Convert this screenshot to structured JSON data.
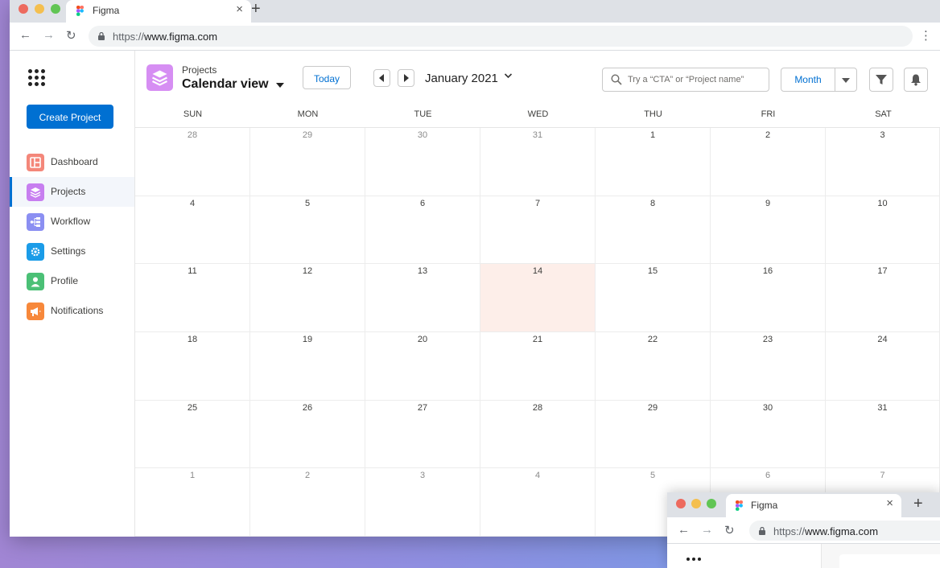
{
  "browser": {
    "tab_title": "Figma",
    "url_scheme": "https://",
    "url_host": "www.figma.com",
    "traffic_lights": [
      "#ed6a5e",
      "#f4bf4f",
      "#61c554"
    ]
  },
  "sidebar": {
    "create_label": "Create Project",
    "items": [
      {
        "label": "Dashboard",
        "icon": "dashboard-icon",
        "color": "#f4877a",
        "active": false
      },
      {
        "label": "Projects",
        "icon": "layers-icon",
        "color": "#c77ef0",
        "active": true
      },
      {
        "label": "Workflow",
        "icon": "workflow-icon",
        "color": "#8b8ff2",
        "active": false
      },
      {
        "label": "Settings",
        "icon": "gear-icon",
        "color": "#1b9ce8",
        "active": false
      },
      {
        "label": "Profile",
        "icon": "person-icon",
        "color": "#4bc076",
        "active": false
      },
      {
        "label": "Notifications",
        "icon": "megaphone-icon",
        "color": "#f7883b",
        "active": false
      }
    ]
  },
  "header": {
    "eyebrow": "Projects",
    "title": "Calendar view",
    "today_label": "Today",
    "month_label": "January 2021",
    "search_placeholder": "Try a “CTA” or “Project name”",
    "view_select": "Month",
    "accent": "#0070d2"
  },
  "calendar": {
    "weekdays": [
      "SUN",
      "MON",
      "TUE",
      "WED",
      "THU",
      "FRI",
      "SAT"
    ],
    "today": 14,
    "today_color": "#fdeee9",
    "weeks": [
      [
        {
          "d": "28",
          "m": true
        },
        {
          "d": "29",
          "m": true
        },
        {
          "d": "30",
          "m": true
        },
        {
          "d": "31",
          "m": true
        },
        {
          "d": "1"
        },
        {
          "d": "2"
        },
        {
          "d": "3"
        }
      ],
      [
        {
          "d": "4"
        },
        {
          "d": "5"
        },
        {
          "d": "6"
        },
        {
          "d": "7"
        },
        {
          "d": "8"
        },
        {
          "d": "9"
        },
        {
          "d": "10"
        }
      ],
      [
        {
          "d": "11"
        },
        {
          "d": "12"
        },
        {
          "d": "13"
        },
        {
          "d": "14",
          "t": true
        },
        {
          "d": "15"
        },
        {
          "d": "16"
        },
        {
          "d": "17"
        }
      ],
      [
        {
          "d": "18"
        },
        {
          "d": "19"
        },
        {
          "d": "20"
        },
        {
          "d": "21"
        },
        {
          "d": "22"
        },
        {
          "d": "23"
        },
        {
          "d": "24"
        }
      ],
      [
        {
          "d": "25"
        },
        {
          "d": "26"
        },
        {
          "d": "27"
        },
        {
          "d": "28"
        },
        {
          "d": "29"
        },
        {
          "d": "30"
        },
        {
          "d": "31"
        }
      ],
      [
        {
          "d": "1",
          "m": true
        },
        {
          "d": "2",
          "m": true
        },
        {
          "d": "3",
          "m": true
        },
        {
          "d": "4",
          "m": true
        },
        {
          "d": "5",
          "m": true
        },
        {
          "d": "6",
          "m": true
        },
        {
          "d": "7",
          "m": true
        }
      ]
    ]
  },
  "second_window": {
    "tab_title": "Figma",
    "url_scheme": "https://",
    "url_host": "www.figma.com"
  }
}
